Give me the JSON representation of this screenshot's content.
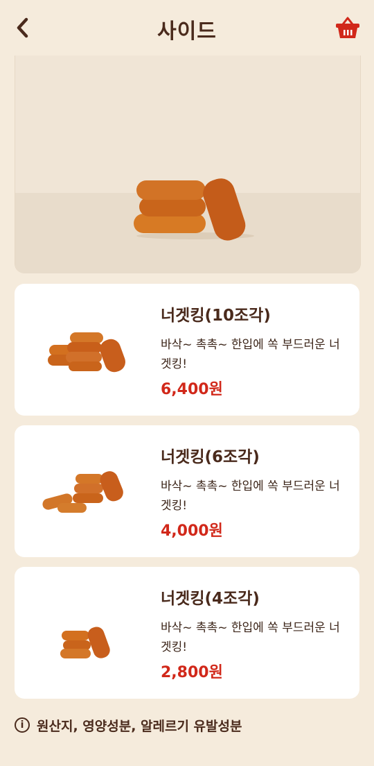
{
  "header": {
    "title": "사이드",
    "back_icon": "chevron-left-icon",
    "cart_icon": "basket-icon"
  },
  "colors": {
    "background": "#f5ebdc",
    "brown": "#4a2a1c",
    "price_red": "#d1281a",
    "basket_red": "#d1281a"
  },
  "menu_items": [
    {
      "name": "너겟킹(10조각)",
      "description": "바삭~ 촉촉~ 한입에 쏙 부드러운 너겟킹!",
      "price": "6,400원"
    },
    {
      "name": "너겟킹(6조각)",
      "description": "바삭~ 촉촉~ 한입에 쏙 부드러운 너겟킹!",
      "price": "4,000원"
    },
    {
      "name": "너겟킹(4조각)",
      "description": "바삭~ 촉촉~ 한입에 쏙 부드러운 너겟킹!",
      "price": "2,800원"
    }
  ],
  "footer": {
    "info_icon": "info-icon",
    "label": "원산지, 영양성분, 알레르기 유발성분"
  }
}
